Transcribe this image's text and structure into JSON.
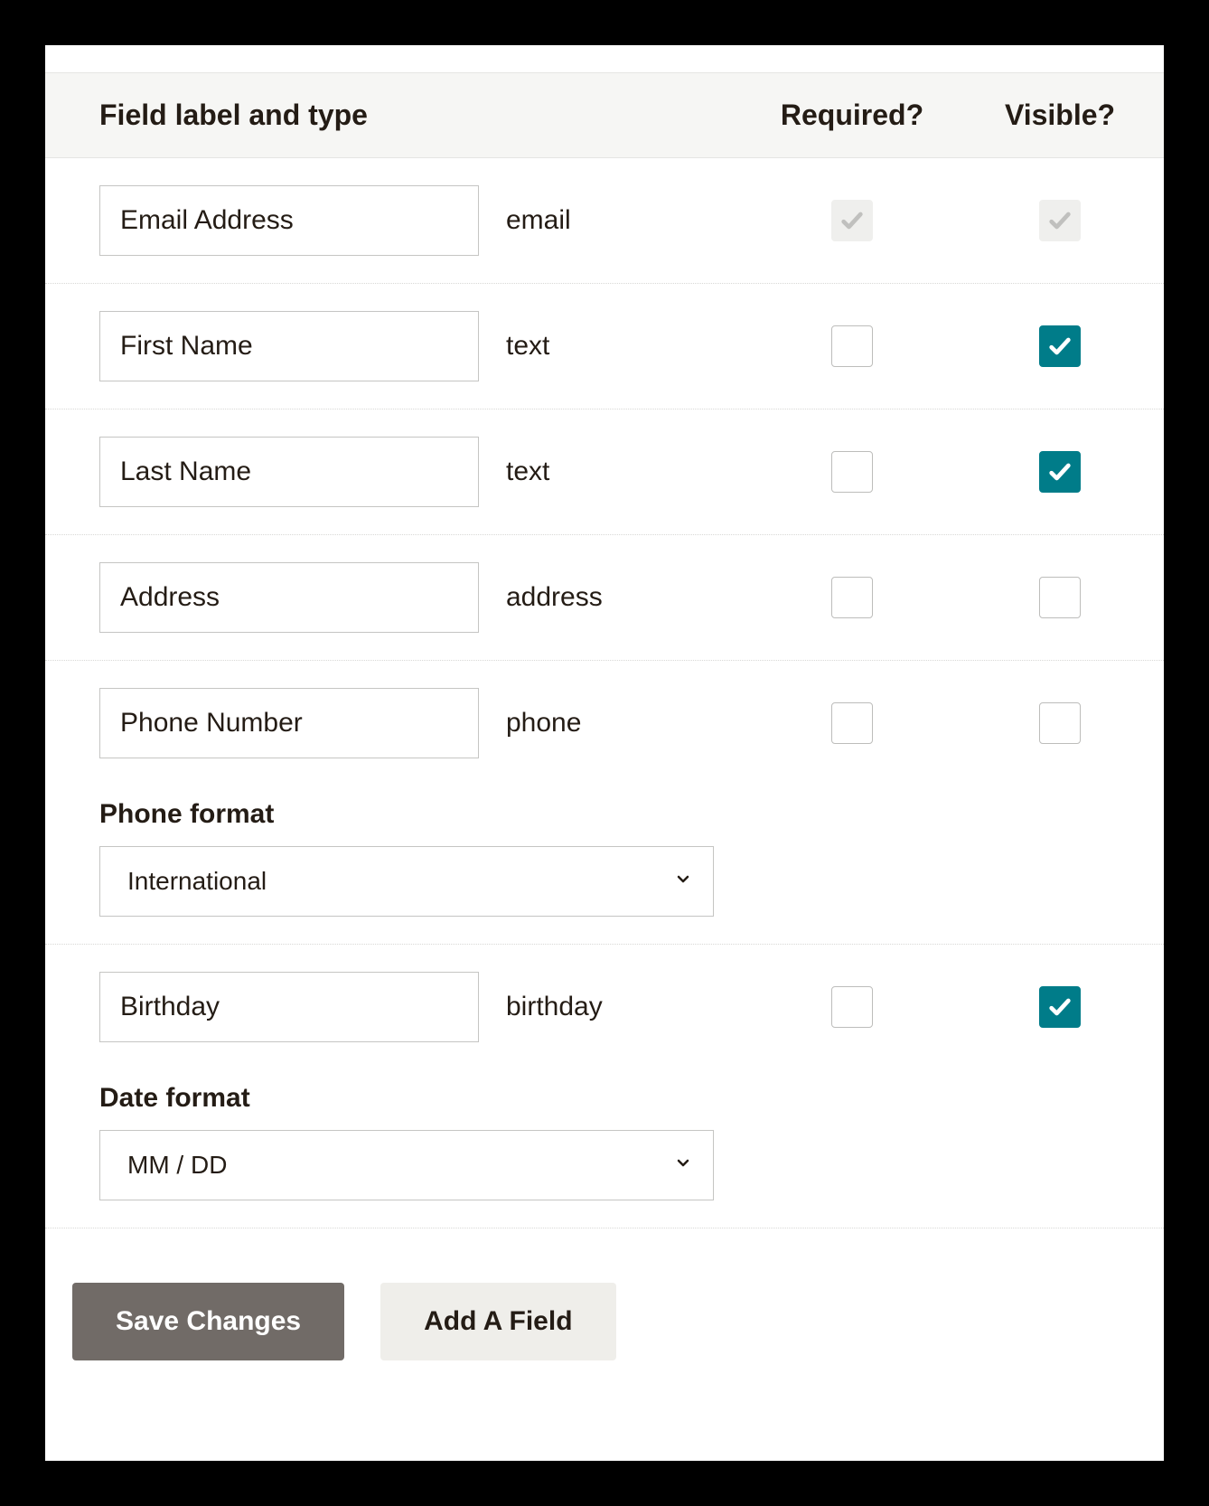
{
  "header": {
    "col_label": "Field label and type",
    "col_required": "Required?",
    "col_visible": "Visible?"
  },
  "fields": [
    {
      "label": "Email Address",
      "type": "email",
      "required_checked": true,
      "required_locked": true,
      "visible_checked": true,
      "visible_locked": true
    },
    {
      "label": "First Name",
      "type": "text",
      "required_checked": false,
      "required_locked": false,
      "visible_checked": true,
      "visible_locked": false
    },
    {
      "label": "Last Name",
      "type": "text",
      "required_checked": false,
      "required_locked": false,
      "visible_checked": true,
      "visible_locked": false
    },
    {
      "label": "Address",
      "type": "address",
      "required_checked": false,
      "required_locked": false,
      "visible_checked": false,
      "visible_locked": false
    },
    {
      "label": "Phone Number",
      "type": "phone",
      "required_checked": false,
      "required_locked": false,
      "visible_checked": false,
      "visible_locked": false,
      "subformat": {
        "label": "Phone format",
        "value": "International"
      }
    },
    {
      "label": "Birthday",
      "type": "birthday",
      "required_checked": false,
      "required_locked": false,
      "visible_checked": true,
      "visible_locked": false,
      "subformat": {
        "label": "Date format",
        "value": "MM / DD"
      }
    }
  ],
  "buttons": {
    "save": "Save Changes",
    "add": "Add A Field"
  }
}
